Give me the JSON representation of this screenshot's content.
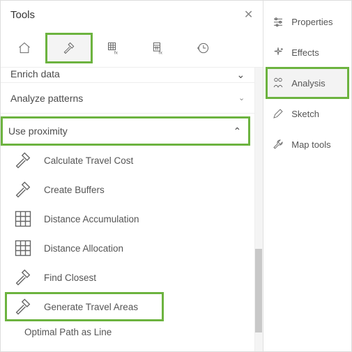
{
  "panel": {
    "title": "Tools",
    "close": "✕"
  },
  "tabs": {
    "home": "home-icon",
    "hammer": "hammer-icon",
    "grid1": "grid-fx-icon",
    "grid2": "calc-fx-icon",
    "history": "history-icon"
  },
  "categories": {
    "enrich_cut": "Enrich data",
    "analyze": "Analyze patterns",
    "use_proximity": "Use proximity"
  },
  "tools": [
    {
      "label": "Calculate Travel Cost",
      "icon": "hammer"
    },
    {
      "label": "Create Buffers",
      "icon": "hammer"
    },
    {
      "label": "Distance Accumulation",
      "icon": "grid"
    },
    {
      "label": "Distance Allocation",
      "icon": "grid"
    },
    {
      "label": "Find Closest",
      "icon": "hammer"
    },
    {
      "label": "Generate Travel Areas",
      "icon": "hammer",
      "highlight": true
    },
    {
      "label": "Optimal Path as Line",
      "icon": "grid"
    }
  ],
  "right": [
    {
      "label": "Properties",
      "icon": "sliders"
    },
    {
      "label": "Effects",
      "icon": "sparkle"
    },
    {
      "label": "Analysis",
      "icon": "analysis",
      "selected": true
    },
    {
      "label": "Sketch",
      "icon": "pencil"
    },
    {
      "label": "Map tools",
      "icon": "wrench"
    }
  ]
}
